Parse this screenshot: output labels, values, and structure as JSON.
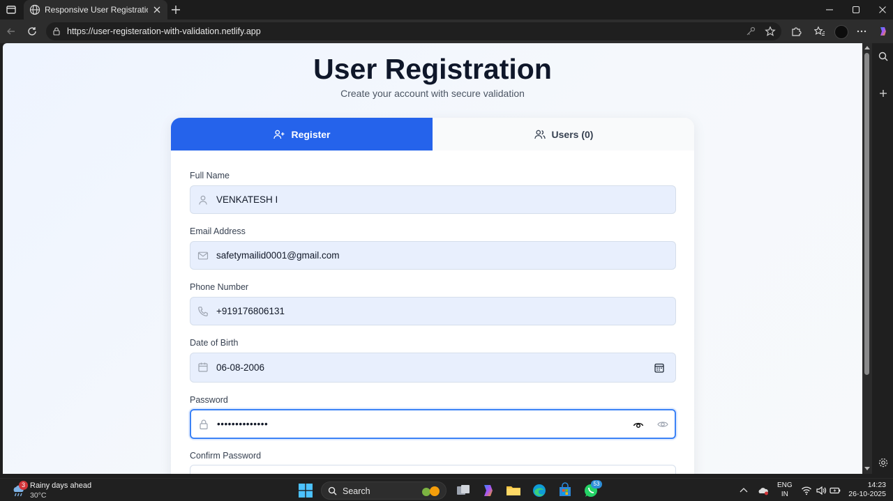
{
  "browser": {
    "tab_title": "Responsive User Registration UI",
    "url": "https://user-registeration-with-validation.netlify.app"
  },
  "page": {
    "title": "User Registration",
    "subtitle": "Create your account with secure validation"
  },
  "tabs": {
    "register_label": "Register",
    "users_label": "Users (0)"
  },
  "form": {
    "fields": [
      {
        "label": "Full Name",
        "value": "VENKATESH I",
        "icon": "user-icon"
      },
      {
        "label": "Email Address",
        "value": "safetymailid0001@gmail.com",
        "icon": "mail-icon"
      },
      {
        "label": "Phone Number",
        "value": "+919176806131",
        "icon": "phone-icon"
      },
      {
        "label": "Date of Birth",
        "value": "06-08-2006",
        "icon": "calendar-icon"
      },
      {
        "label": "Password",
        "value": "••••••••••••••",
        "icon": "lock-icon"
      },
      {
        "label": "Confirm Password",
        "value": "",
        "icon": "lock-icon"
      }
    ]
  },
  "taskbar": {
    "weather_badge": "3",
    "weather_text": "Rainy days ahead",
    "temperature": "30°C",
    "search_label": "Search",
    "whatsapp_badge": "53",
    "lang_line1": "ENG",
    "lang_line2": "IN",
    "time": "14:23",
    "date": "26-10-2025"
  },
  "colors": {
    "accent": "#2563eb",
    "field_bg": "#e8effd",
    "focus_border": "#3b82f6"
  }
}
